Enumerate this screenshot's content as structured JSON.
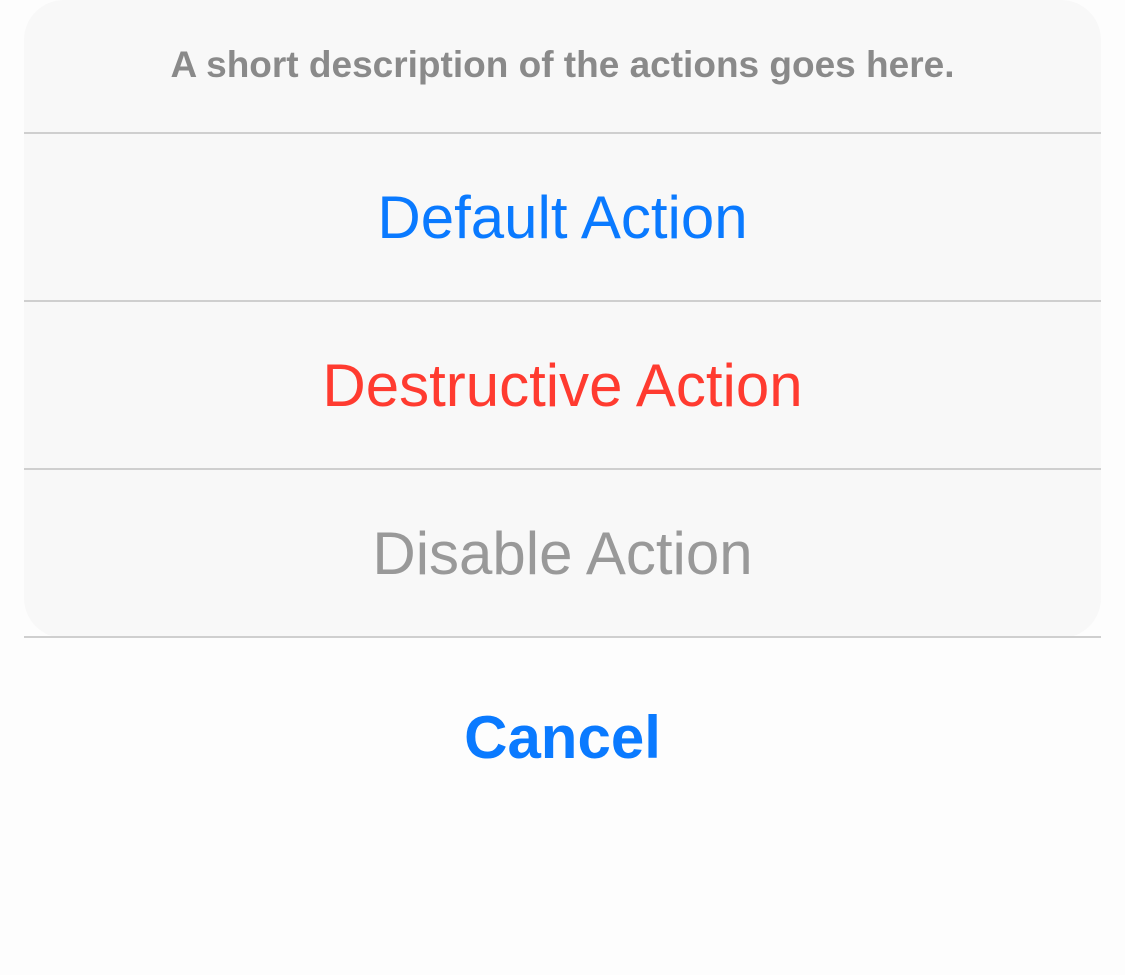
{
  "action_sheet": {
    "message": "A short description of the actions goes here.",
    "actions": [
      {
        "label": "Default Action",
        "style": "default",
        "color": "#0a7aff",
        "enabled": true
      },
      {
        "label": "Destructive Action",
        "style": "destructive",
        "color": "#ff3b30",
        "enabled": true
      },
      {
        "label": "Disable Action",
        "style": "disabled",
        "color": "#999999",
        "enabled": false
      }
    ],
    "cancel": {
      "label": "Cancel",
      "color": "#0a7aff"
    }
  }
}
